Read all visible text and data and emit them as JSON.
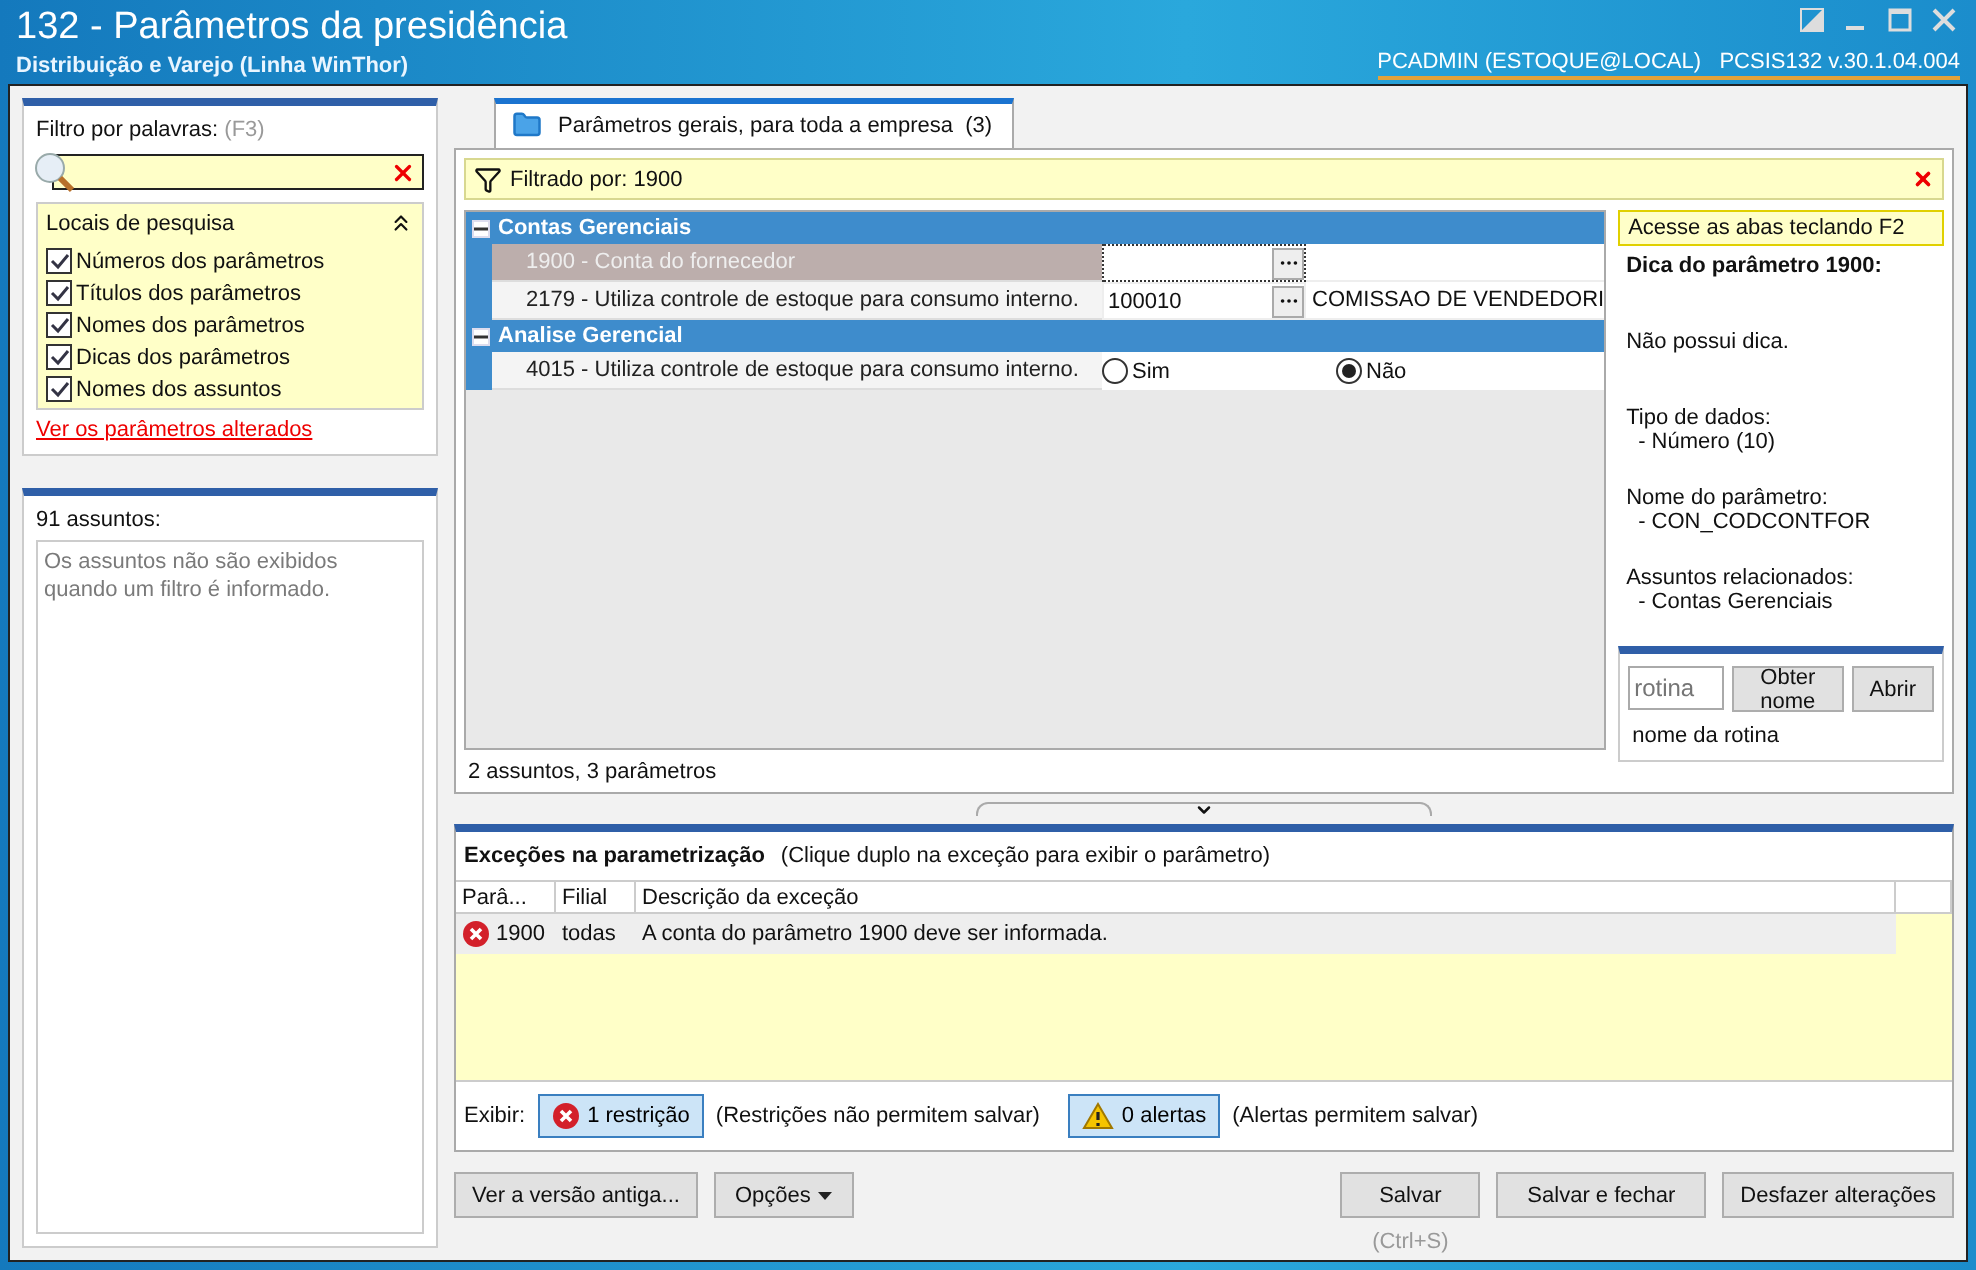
{
  "window": {
    "title": "132 - Parâmetros da presidência",
    "subtitle": "Distribuição e Varejo (Linha WinThor)",
    "user": "PCADMIN (ESTOQUE@LOCAL)",
    "version": "PCSIS132  v.30.1.04.004"
  },
  "filter": {
    "label": "Filtro por palavras:",
    "shortcut": "(F3)",
    "locations": {
      "title": "Locais de pesquisa",
      "expanded": true,
      "items": [
        {
          "label": "Números dos parâmetros",
          "checked": true
        },
        {
          "label": "Títulos dos parâmetros",
          "checked": true
        },
        {
          "label": "Nomes dos parâmetros",
          "checked": true
        },
        {
          "label": "Dicas dos parâmetros",
          "checked": true
        },
        {
          "label": "Nomes dos assuntos",
          "checked": true
        }
      ]
    },
    "link": "Ver os parâmetros alterados"
  },
  "subjects": {
    "count": "91 assuntos:",
    "note": "Os assuntos não são exibidos quando um filtro é informado."
  },
  "tabs": [
    {
      "label": "Parâmetros gerais, para toda a empresa",
      "count": "(3)",
      "selected": true
    }
  ],
  "filter_bar": {
    "text": "Filtrado por: 1900"
  },
  "groups": [
    {
      "name": "Contas Gerenciais",
      "expanded": true,
      "params": [
        {
          "kind": "lookup",
          "label": "1900 - Conta do fornecedor",
          "selected": true
        },
        {
          "kind": "lookup",
          "label": "2179 - Utiliza controle de estoque para consumo interno.",
          "value": "100010",
          "description": "COMISSAO DE VENDEDORI",
          "selected": false
        }
      ]
    },
    {
      "name": "Analise Gerencial",
      "expanded": true,
      "params": [
        {
          "kind": "radio",
          "label": "4015 - Utiliza controle de estoque para consumo interno.",
          "selected": false,
          "options": [
            {
              "label": "Sim",
              "selected": false
            },
            {
              "label": "Não",
              "selected": true
            }
          ]
        }
      ]
    }
  ],
  "tip": {
    "hint": "Acesse as abas teclando F2",
    "title": "Dica do parâmetro 1900:",
    "body": "Não possui dica.",
    "sections": [
      {
        "heading": "Tipo de dados:",
        "value": "- Número (10)"
      },
      {
        "heading": "Nome do parâmetro:",
        "value": "- CON_CODCONTFOR"
      },
      {
        "heading": "Assuntos relacionados:",
        "value": "- Contas Gerenciais"
      }
    ]
  },
  "routine": {
    "placeholder": "rotina",
    "buttons": [
      "Obter nome",
      "Abrir"
    ],
    "caption": "nome da rotina"
  },
  "summary": "2 assuntos, 3 parâmetros",
  "exceptions": {
    "title": "Exceções na parametrização",
    "hint": "(Clique duplo na exceção para exibir o parâmetro)",
    "columns": [
      "Parâ...",
      "Filial",
      "Descrição da exceção"
    ],
    "rows": [
      {
        "kind": "error",
        "param": "1900",
        "branch": "todas",
        "description": "A conta do parâmetro 1900 deve ser informada."
      }
    ]
  },
  "display": {
    "label": "Exibir:",
    "toggles": [
      {
        "kind": "error",
        "label": "1 restrição",
        "note": "(Restrições não permitem salvar)",
        "on": true
      },
      {
        "kind": "warning",
        "label": "0 alertas",
        "note": "(Alertas permitem salvar)",
        "on": true
      }
    ]
  },
  "buttons": {
    "left": [
      {
        "kind": "plain",
        "label": "Ver a versão antiga..."
      },
      {
        "kind": "menu",
        "label": "Opções"
      }
    ],
    "right": [
      "Salvar",
      "Salvar e fechar",
      "Desfazer alterações"
    ],
    "shortcut": "(Ctrl+S)"
  }
}
